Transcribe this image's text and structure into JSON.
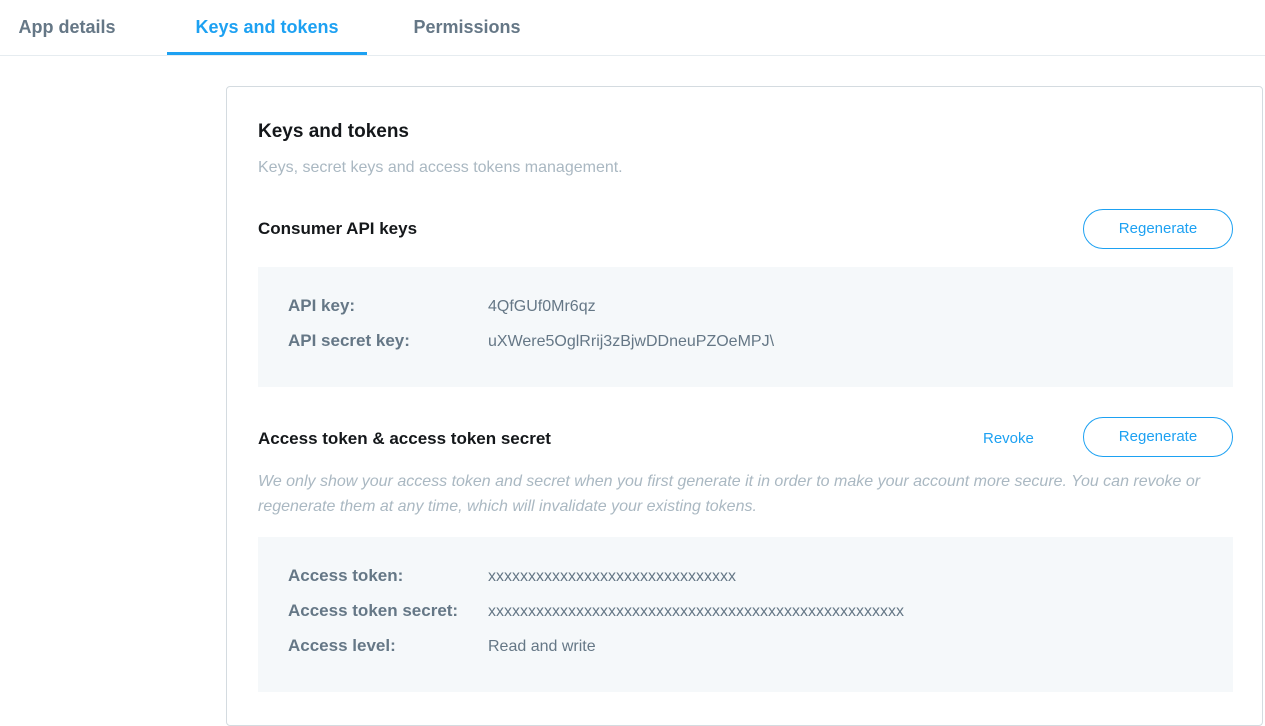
{
  "tabs": [
    {
      "label": "App details"
    },
    {
      "label": "Keys and tokens"
    },
    {
      "label": "Permissions"
    }
  ],
  "card": {
    "title": "Keys and tokens",
    "subtitle": "Keys, secret keys and access tokens management."
  },
  "consumer": {
    "title": "Consumer API keys",
    "regenerate_label": "Regenerate",
    "rows": [
      {
        "label": "API key:",
        "value": "4QfGUf0Mr6qz"
      },
      {
        "label": "API secret key:",
        "value": "uXWere5OglRrij3zBjwDDneuPZOeMPJ\\"
      }
    ]
  },
  "access": {
    "title": "Access token & access token secret",
    "revoke_label": "Revoke",
    "regenerate_label": "Regenerate",
    "note": "We only show your access token and secret when you first generate it in order to make your account more secure. You can revoke or regenerate them at any time, which will invalidate your existing tokens.",
    "rows": [
      {
        "label": "Access token:",
        "value": "xxxxxxxxxxxxxxxxxxxxxxxxxxxxxxx"
      },
      {
        "label": "Access token secret:",
        "value": "xxxxxxxxxxxxxxxxxxxxxxxxxxxxxxxxxxxxxxxxxxxxxxxxxxxx"
      },
      {
        "label": "Access level:",
        "value": "Read and write"
      }
    ]
  },
  "colors": {
    "accent": "#1da1f2",
    "panel_bg": "#f5f8fa",
    "muted_text": "#657786"
  }
}
